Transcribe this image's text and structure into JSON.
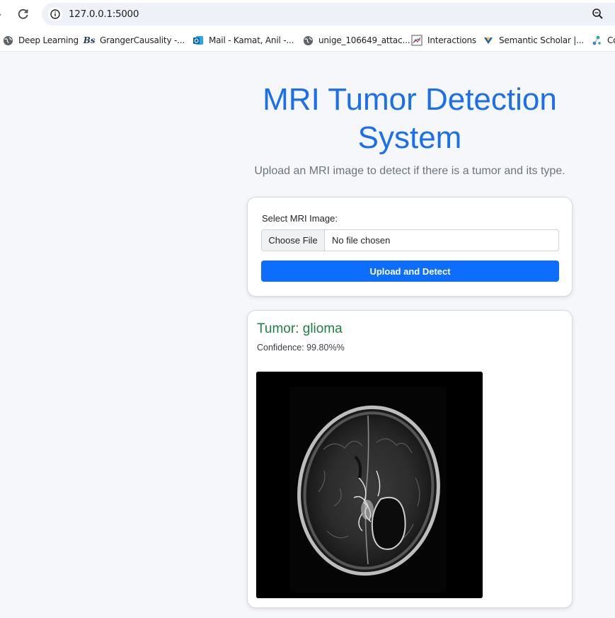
{
  "browser": {
    "url": "127.0.0.1:5000",
    "bookmarks": [
      {
        "label": "Deep Learning",
        "icon": "globe-icon"
      },
      {
        "label": "GrangerCausality -...",
        "icon": "bs-icon"
      },
      {
        "label": "Mail - Kamat, Anil -...",
        "icon": "outlook-icon"
      },
      {
        "label": "unige_106649_attac...",
        "icon": "globe-icon"
      },
      {
        "label": "Interactions",
        "icon": "chart-thumbnail-icon"
      },
      {
        "label": "Semantic Scholar |...",
        "icon": "semantic-scholar-icon"
      },
      {
        "label": "Co",
        "icon": "connected-dots-icon"
      }
    ]
  },
  "page": {
    "title": "MRI Tumor Detection System",
    "subtitle": "Upload an MRI image to detect if there is a tumor and its type."
  },
  "upload": {
    "field_label": "Select MRI Image:",
    "choose_file_label": "Choose File",
    "file_status": "No file chosen",
    "submit_label": "Upload and Detect"
  },
  "result": {
    "tumor_text": "Tumor: glioma",
    "confidence_text": "Confidence: 99.80%%"
  },
  "colors": {
    "accent": "#0d6efd",
    "title": "#1a6ef0",
    "result": "#1e7e45"
  }
}
